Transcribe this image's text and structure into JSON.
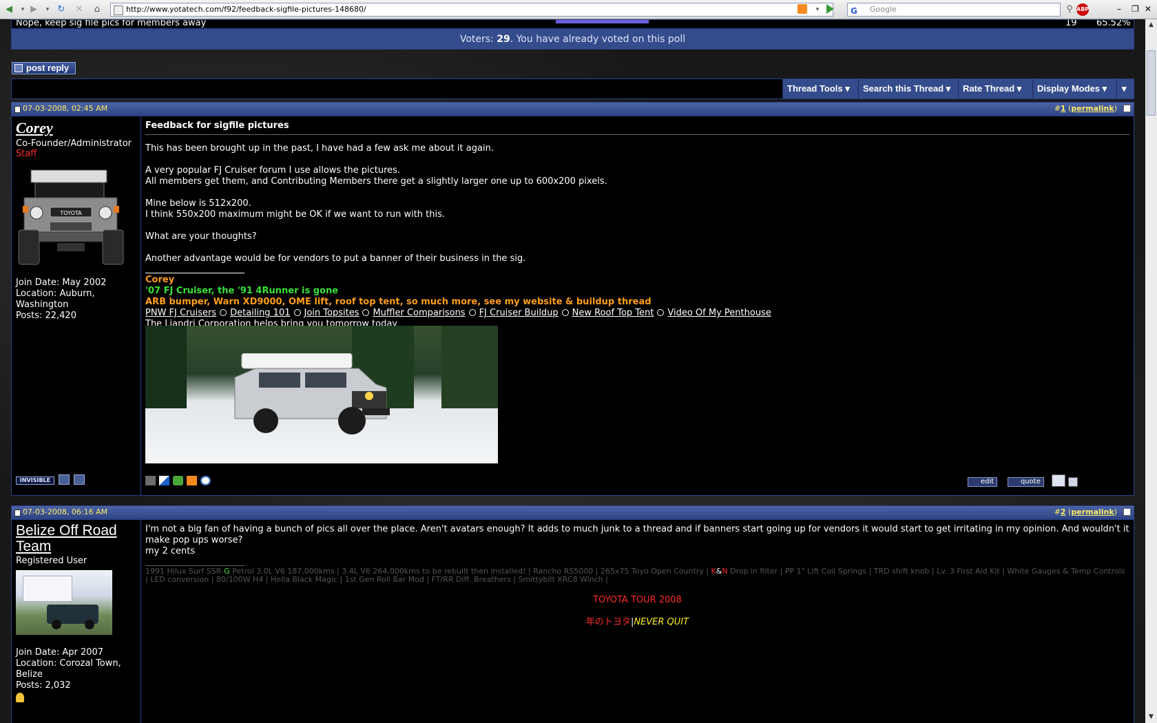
{
  "browser": {
    "url": "http://www.yotatech.com/f92/feedback-sigfile-pictures-148680/",
    "search_placeholder": "Google",
    "search_logo": "G",
    "abp_label": "ABP"
  },
  "poll": {
    "last_option": "Nope, keep sig file pics for members away",
    "last_count": "19",
    "last_percent": "65.52%",
    "voters_label": "Voters:",
    "voters_count": "29",
    "voters_suffix": ". You have already voted on this poll"
  },
  "actions": {
    "post_reply": "post reply"
  },
  "toolbar": {
    "thread_tools": "Thread Tools",
    "search_thread": "Search this Thread",
    "rate_thread": "Rate Thread",
    "display_modes": "Display Modes",
    "arrow": "▾"
  },
  "posts": [
    {
      "date": "07-03-2008, 02:45 AM",
      "number": "1",
      "permalink": "permalink",
      "username": "Corey",
      "usertitle": "Co-Founder/Administrator",
      "rank": "Staff",
      "join_date": "Join Date: May 2002",
      "location": "Location: Auburn, Washington",
      "posts": "Posts: 22,420",
      "title": "Feedback for sigfile pictures",
      "body": [
        "This has been brought up in the past, I have had a few ask me about it again.",
        "",
        "A very popular FJ Cruiser forum I use allows the pictures.",
        "All members get them, and Contributing Members there get a slightly larger one up to 600x200 pixels.",
        "",
        "Mine below is 512x200.",
        "I think 550x200 maximum might be OK if we want to run with this.",
        "",
        "What are your thoughts?",
        "",
        "Another advantage would be for vendors to put a banner of their business in the sig."
      ],
      "sig_name": "Corey",
      "sig_line1": "'07 FJ Cruiser, the '91 4Runner is gone",
      "sig_line2": "ARB bumper, Warn XD9000, OME lift, roof top tent, so much more, see my website & buildup thread",
      "sig_links": [
        "PNW FJ Cruisers",
        "Detailing 101",
        "Join Topsites",
        "Muffler Comparisons",
        "FJ Cruiser Buildup",
        "New Roof Top Tent",
        "Video Of My Penthouse"
      ],
      "sig_link_last": "The Liandri Corporation helps bring you tomorrow today",
      "invisible_label": "INVISIBLE",
      "edit_label": "edit",
      "quote_label": "quote"
    },
    {
      "date": "07-03-2008, 06:16 AM",
      "number": "2",
      "permalink": "permalink",
      "username": "Belize Off Road Team",
      "usertitle": "Registered User",
      "join_date": "Join Date: Apr 2007",
      "location": "Location: Corozal Town, Belize",
      "posts": "Posts: 2,032",
      "body": [
        "I'm not a big fan of having a bunch of pics all over the place. Aren't avatars enough? It adds to much junk to a thread and if banners start going up for vendors it would start to get irritating in my opinion. And wouldn't it make pop ups worse?",
        "my 2 cents"
      ],
      "sig_gray_pre": "1991 Hilux Surf SSR-",
      "sig_gray_g": "G",
      "sig_gray_mid": " Petrol 3.0L V6 187,000kms | 3.4L V6 264,000kms to be rebuilt then installed! | Rancho RS5000 | 265x75 Toyo Open Country | ",
      "sig_gray_kn_k": "K",
      "sig_gray_kn_amp": "&",
      "sig_gray_kn_n": "N",
      "sig_gray_post": " Drop in filter | PP 1\" Lift Coil Springs | TRD shift knob | Lv. 3 First Aid Kit | White Gauges & Temp Controls | LED conversion | 80/100W H4 | Hella Black Magic | 1st Gen Roll Bar Mod | FT/RR Diff. Breathers | Smittybilt XRC8 Winch |",
      "tour": "TOYOTA TOUR 2008",
      "jp": "年のトヨタ",
      "sep": "|",
      "never_quit": "NEVER QUIT"
    }
  ],
  "colors": {
    "page_bg": "#181818",
    "panel_blue": "#344c8c",
    "border_blue": "#2b3f86",
    "date_yellow": "#ffee66",
    "staff_red": "#ff2a2a",
    "sig_orange": "#ff9e1b",
    "sig_green": "#38e238"
  }
}
